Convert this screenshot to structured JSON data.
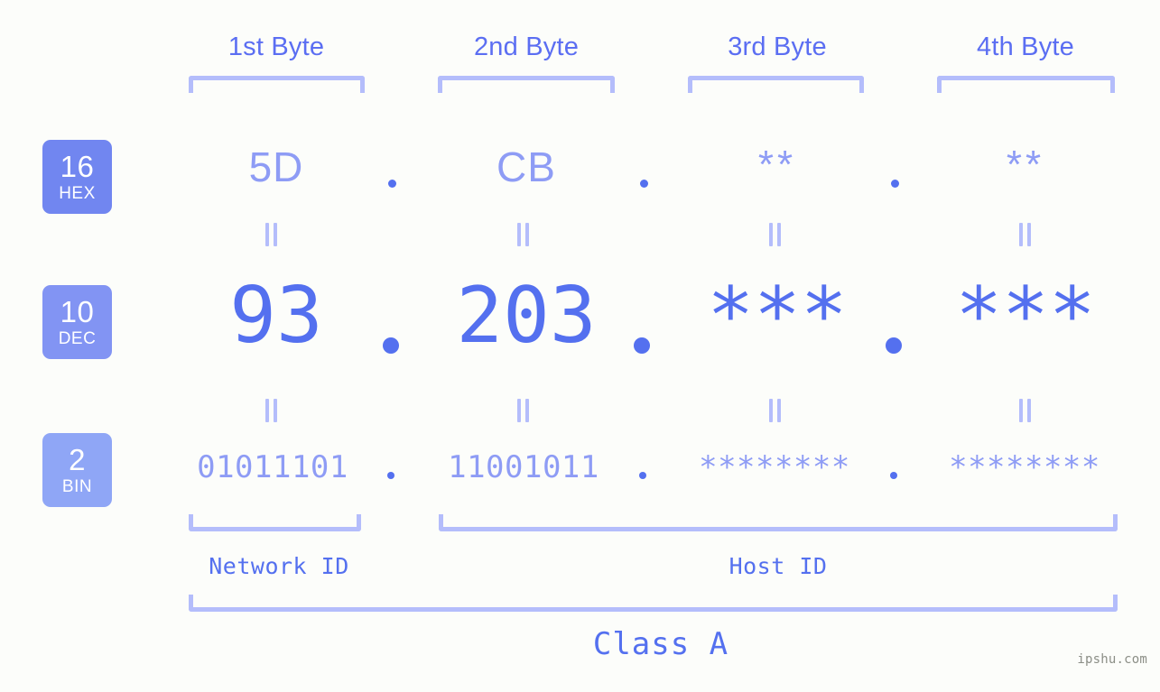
{
  "background_color": "#fcfdfa",
  "accent_color": "#5470ef",
  "accent_light": "#8e9cf5",
  "accent_pale": "#b4bdfb",
  "byte_headers": [
    {
      "label": "1st Byte"
    },
    {
      "label": "2nd Byte"
    },
    {
      "label": "3rd Byte"
    },
    {
      "label": "4th Byte"
    }
  ],
  "bases": [
    {
      "number": "16",
      "name": "HEX",
      "color": "#7186f0"
    },
    {
      "number": "10",
      "name": "DEC",
      "color": "#8294f3"
    },
    {
      "number": "2",
      "name": "BIN",
      "color": "#8fa6f6"
    }
  ],
  "rows": {
    "hex": {
      "base_number": "16",
      "base_name": "HEX",
      "values": [
        "5D",
        "CB",
        "**",
        "**"
      ],
      "separator": "."
    },
    "dec": {
      "base_number": "10",
      "base_name": "DEC",
      "values": [
        "93",
        "203",
        "***",
        "***"
      ],
      "separator": "."
    },
    "bin": {
      "base_number": "2",
      "base_name": "BIN",
      "values": [
        "01011101",
        "11001011",
        "********",
        "********"
      ],
      "separator": "."
    }
  },
  "equivalence_mark": "||",
  "segments": {
    "network_id": "Network ID",
    "host_id": "Host ID",
    "class": "Class A"
  },
  "watermark": "ipshu.com"
}
